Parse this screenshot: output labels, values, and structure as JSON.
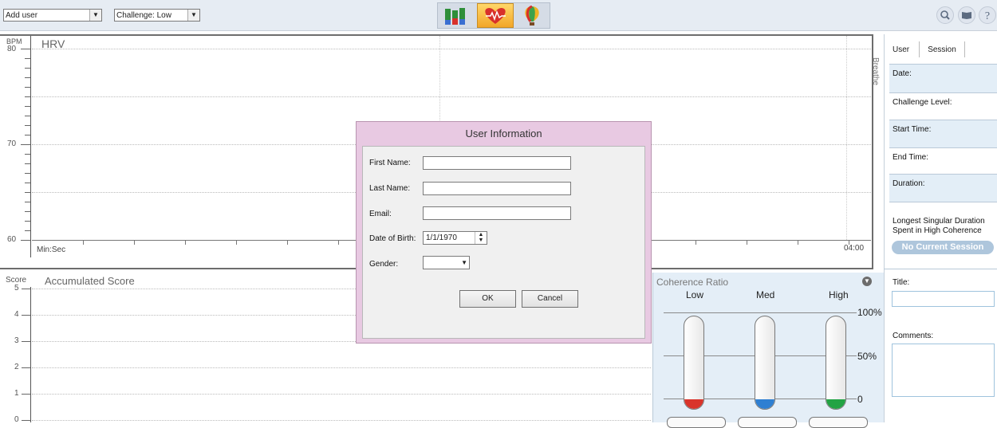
{
  "toolbar": {
    "user_select": "Add user",
    "challenge_select": "Challenge: Low"
  },
  "hrv": {
    "y_unit": "BPM",
    "title": "HRV",
    "y_ticks": [
      "80",
      "70",
      "60"
    ],
    "x_label": "Min:Sec",
    "x_end": "04:00",
    "breathe_label": "Breathe"
  },
  "score": {
    "y_unit": "Score",
    "title": "Accumulated Score",
    "y_ticks": [
      "5",
      "4",
      "3",
      "2",
      "1",
      "0"
    ]
  },
  "coherence": {
    "title": "Coherence Ratio",
    "columns": [
      "Low",
      "Med",
      "High"
    ],
    "scale": [
      "100%",
      "50%",
      "0"
    ],
    "colors": {
      "low": "#d9342b",
      "med": "#2e7fd2",
      "high": "#22a344"
    }
  },
  "session_panel": {
    "tabs": [
      "User",
      "Session"
    ],
    "fields": [
      "Date:",
      "Challenge Level:",
      "Start Time:",
      "End Time:",
      "Duration:"
    ],
    "longest_label": "Longest Singular Duration Spent in High Coherence",
    "no_session": "No Current Session",
    "title_label": "Title:",
    "comments_label": "Comments:"
  },
  "dialog": {
    "title": "User Information",
    "first_name_label": "First Name:",
    "last_name_label": "Last Name:",
    "email_label": "Email:",
    "dob_label": "Date of Birth:",
    "dob_value": "1/1/1970",
    "gender_label": "Gender:",
    "ok": "OK",
    "cancel": "Cancel"
  }
}
